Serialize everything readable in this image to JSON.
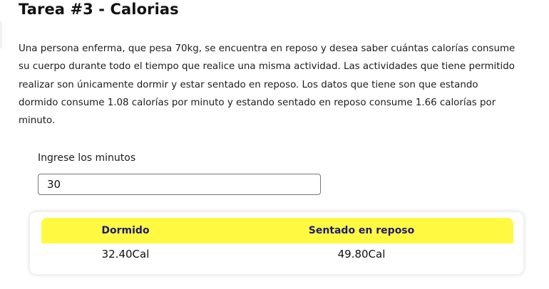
{
  "page": {
    "title": "Tarea #3 - Calorias",
    "description": "Una persona enferma, que pesa 70kg, se encuentra en reposo y desea saber cuántas calorías consume su cuerpo durante todo el tiempo que realice una misma actividad. Las actividades que tiene permitido realizar son únicamente dormir y estar sentado en reposo. Los datos que tiene son que estando dormido consume 1.08 calorías por minuto y estando sentado en reposo consume 1.66 calorías por minuto."
  },
  "form": {
    "minutes_label": "Ingrese los minutos",
    "minutes_value": "30"
  },
  "results": {
    "headers": [
      "Dormido",
      "Sentado en reposo"
    ],
    "values": [
      "32.40Cal",
      "49.80Cal"
    ]
  },
  "colors": {
    "header_background": "#fff941",
    "header_text": "#1d1a7a"
  }
}
